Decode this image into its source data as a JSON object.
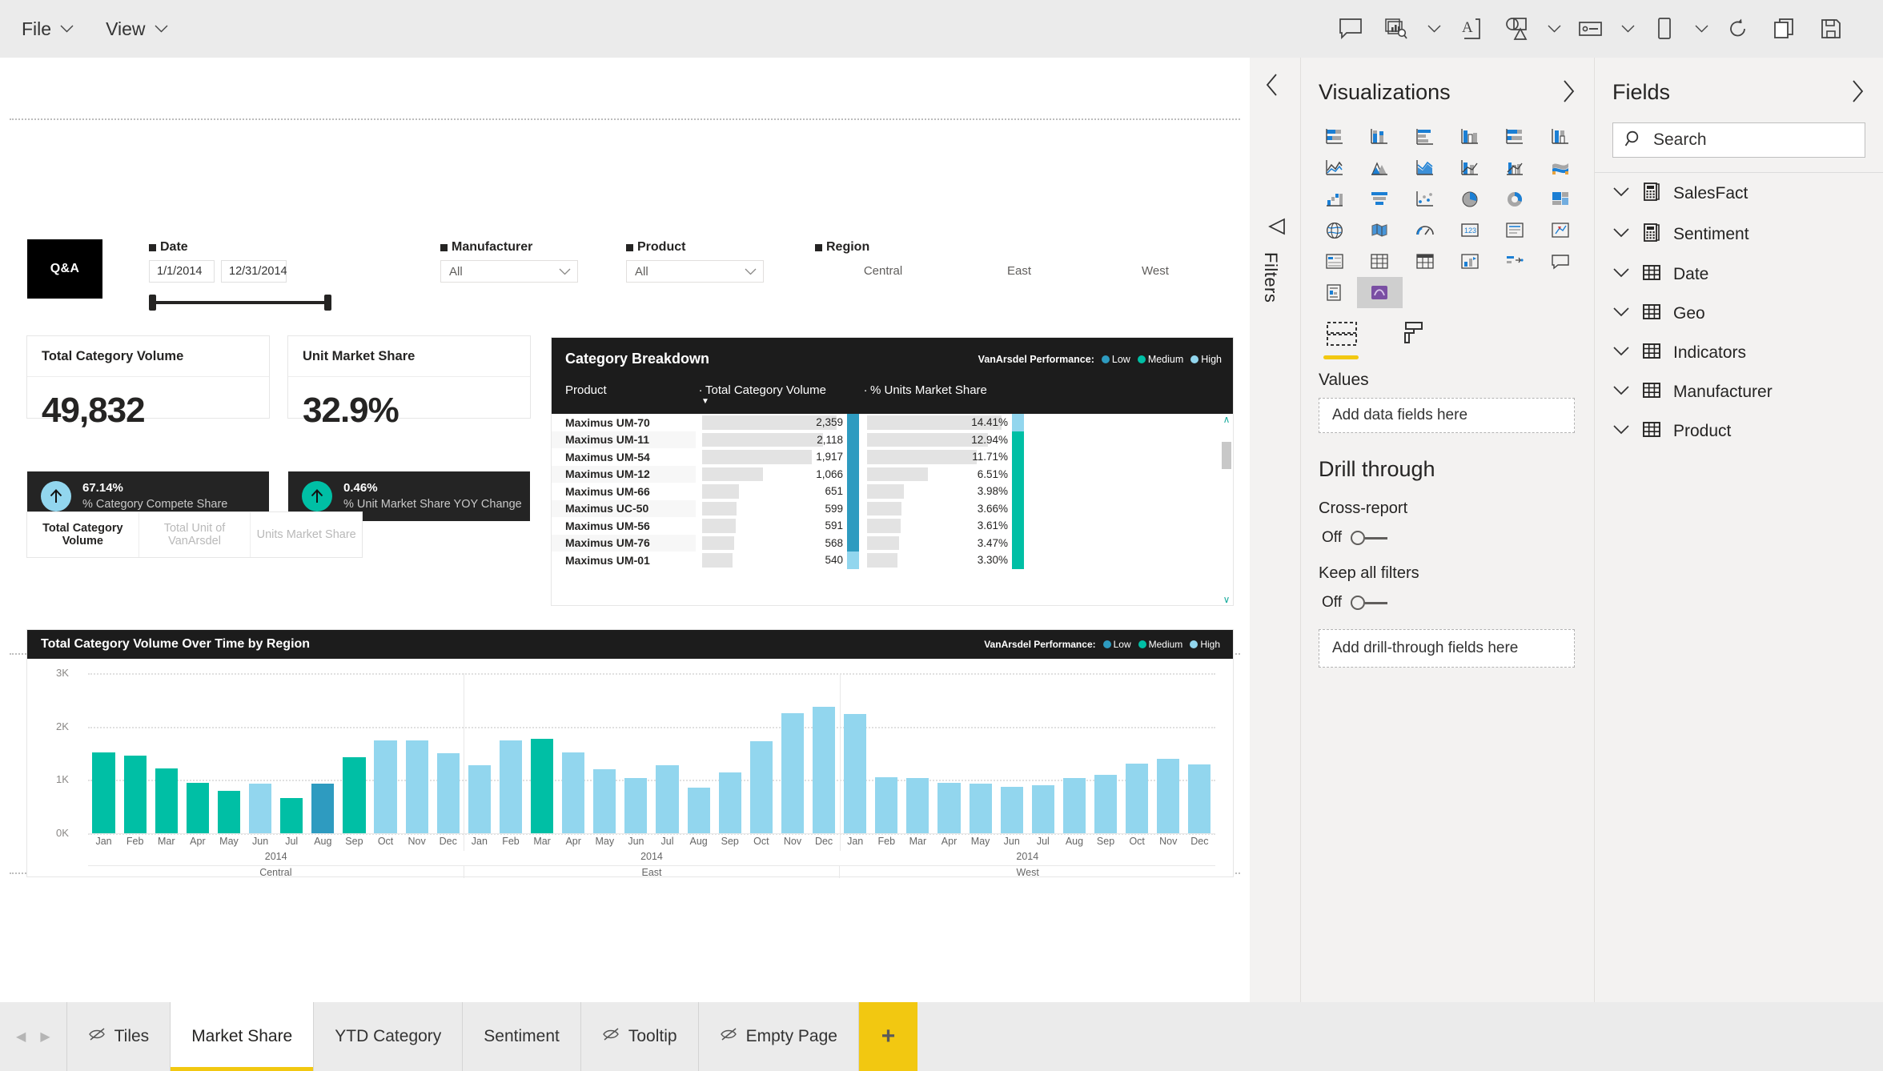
{
  "ribbon": {
    "menus": [
      {
        "label": "File"
      },
      {
        "label": "View"
      }
    ],
    "tools": [
      {
        "name": "comment-icon",
        "title": "Comment"
      },
      {
        "name": "visual-gallery-icon",
        "title": "From Marketplace"
      },
      {
        "name": "text-box-icon",
        "title": "Text box"
      },
      {
        "name": "shapes-icon",
        "title": "Shapes"
      },
      {
        "name": "buttons-icon",
        "title": "Buttons"
      },
      {
        "name": "phone-layout-icon",
        "title": "Phone layout"
      },
      {
        "name": "refresh-icon",
        "title": "Refresh"
      },
      {
        "name": "duplicate-page-icon",
        "title": "Duplicate page"
      },
      {
        "name": "save-icon",
        "title": "Save"
      }
    ]
  },
  "canvas": {
    "qna_label": "Q&A",
    "slicers": {
      "date": {
        "title": "Date",
        "start": "1/1/2014",
        "end": "12/31/2014"
      },
      "manufacturer": {
        "title": "Manufacturer",
        "value": "All"
      },
      "product": {
        "title": "Product",
        "value": "All"
      },
      "region": {
        "title": "Region",
        "items": [
          "Central",
          "East",
          "West"
        ]
      }
    },
    "kpi_cards": [
      {
        "title": "Total Category Volume",
        "value": "49,832",
        "delta_value": "67.14%",
        "delta_label": "% Category Compete Share",
        "delta_color": "#92D6EE"
      },
      {
        "title": "Unit Market Share",
        "value": "32.9%",
        "delta_value": "0.46%",
        "delta_label": "% Unit Market Share YOY Change",
        "delta_color": "#00BFA5"
      }
    ],
    "measure_tabs": [
      {
        "label": "Total Category Volume",
        "active": true
      },
      {
        "label": "Total Unit of VanArsdel",
        "active": false
      },
      {
        "label": "Units Market Share",
        "active": false
      }
    ],
    "category_breakdown": {
      "title": "Category Breakdown",
      "legend_title": "VanArsdel Performance:",
      "legend": [
        {
          "label": "Low",
          "color": "#2E9BC0"
        },
        {
          "label": "Medium",
          "color": "#00BFA5"
        },
        {
          "label": "High",
          "color": "#92D6EE"
        }
      ],
      "columns": [
        "Product",
        "Total Category Volume",
        "% Units Market Share"
      ],
      "sorted_by": "Total Category Volume",
      "rows": [
        {
          "product": "Maximus UM-70",
          "volume": "2,359",
          "volume_num": 2359,
          "share": "14.41%",
          "share_num": 14.41,
          "vol_flag": "#2E9BC0",
          "share_flag": "#92D6EE"
        },
        {
          "product": "Maximus UM-11",
          "volume": "2,118",
          "volume_num": 2118,
          "share": "12.94%",
          "share_num": 12.94,
          "vol_flag": "#2E9BC0",
          "share_flag": "#00BFA5"
        },
        {
          "product": "Maximus UM-54",
          "volume": "1,917",
          "volume_num": 1917,
          "share": "11.71%",
          "share_num": 11.71,
          "vol_flag": "#2E9BC0",
          "share_flag": "#00BFA5"
        },
        {
          "product": "Maximus UM-12",
          "volume": "1,066",
          "volume_num": 1066,
          "share": "6.51%",
          "share_num": 6.51,
          "vol_flag": "#2E9BC0",
          "share_flag": "#00BFA5"
        },
        {
          "product": "Maximus UM-66",
          "volume": "651",
          "volume_num": 651,
          "share": "3.98%",
          "share_num": 3.98,
          "vol_flag": "#2E9BC0",
          "share_flag": "#00BFA5"
        },
        {
          "product": "Maximus UC-50",
          "volume": "599",
          "volume_num": 599,
          "share": "3.66%",
          "share_num": 3.66,
          "vol_flag": "#2E9BC0",
          "share_flag": "#00BFA5"
        },
        {
          "product": "Maximus UM-56",
          "volume": "591",
          "volume_num": 591,
          "share": "3.61%",
          "share_num": 3.61,
          "vol_flag": "#2E9BC0",
          "share_flag": "#00BFA5"
        },
        {
          "product": "Maximus UM-76",
          "volume": "568",
          "volume_num": 568,
          "share": "3.47%",
          "share_num": 3.47,
          "vol_flag": "#2E9BC0",
          "share_flag": "#00BFA5"
        },
        {
          "product": "Maximus UM-01",
          "volume": "540",
          "volume_num": 540,
          "share": "3.30%",
          "share_num": 3.3,
          "vol_flag": "#92D6EE",
          "share_flag": "#00BFA5"
        }
      ]
    },
    "chart_panel": {
      "title": "Total Category Volume Over Time by Region",
      "legend_title": "VanArsdel Performance:",
      "legend": [
        {
          "label": "Low",
          "color": "#2E9BC0"
        },
        {
          "label": "Medium",
          "color": "#00BFA5"
        },
        {
          "label": "High",
          "color": "#92D6EE"
        }
      ]
    }
  },
  "chart_data": {
    "type": "bar",
    "title": "Total Category Volume Over Time by Region",
    "xlabel": "",
    "ylabel": "",
    "ylim": [
      0,
      3000
    ],
    "ytick_labels": [
      "0K",
      "1K",
      "2K",
      "3K"
    ],
    "ytick_values": [
      0,
      1000,
      2000,
      3000
    ],
    "grid": true,
    "legend_position": "top-right",
    "year": "2014",
    "group_label_key": "Region",
    "categories": [
      "Jan",
      "Feb",
      "Mar",
      "Apr",
      "May",
      "Jun",
      "Jul",
      "Aug",
      "Sep",
      "Oct",
      "Nov",
      "Dec",
      "Jan",
      "Feb",
      "Mar",
      "Apr",
      "May",
      "Jun",
      "Jul",
      "Aug",
      "Sep",
      "Oct",
      "Nov",
      "Dec",
      "Jan",
      "Feb",
      "Mar",
      "Apr",
      "May",
      "Jun",
      "Jul",
      "Aug",
      "Sep",
      "Oct",
      "Nov",
      "Dec"
    ],
    "groups": [
      {
        "name": "Central",
        "count": 12
      },
      {
        "name": "East",
        "count": 12
      },
      {
        "name": "West",
        "count": 12
      }
    ],
    "series": [
      {
        "name": "Total Category Volume",
        "values": [
          1510,
          1450,
          1210,
          940,
          790,
          930,
          660,
          930,
          1430,
          1740,
          1740,
          1500,
          1270,
          1740,
          1770,
          1510,
          1200,
          1040,
          1270,
          860,
          1140,
          1720,
          2250,
          2370,
          2230,
          1050,
          1030,
          940,
          930,
          870,
          900,
          1040,
          1100,
          1310,
          1400,
          1290
        ],
        "colors": [
          "#00BFA5",
          "#00BFA5",
          "#00BFA5",
          "#00BFA5",
          "#00BFA5",
          "#92D6EE",
          "#00BFA5",
          "#2E9BC0",
          "#00BFA5",
          "#92D6EE",
          "#92D6EE",
          "#92D6EE",
          "#92D6EE",
          "#92D6EE",
          "#00BFA5",
          "#92D6EE",
          "#92D6EE",
          "#92D6EE",
          "#92D6EE",
          "#92D6EE",
          "#92D6EE",
          "#92D6EE",
          "#92D6EE",
          "#92D6EE",
          "#92D6EE",
          "#92D6EE",
          "#92D6EE",
          "#92D6EE",
          "#92D6EE",
          "#92D6EE",
          "#92D6EE",
          "#92D6EE",
          "#92D6EE",
          "#92D6EE",
          "#92D6EE",
          "#92D6EE"
        ]
      }
    ]
  },
  "visualizations_pane": {
    "title": "Visualizations",
    "icons": [
      "stacked-bar-chart-icon",
      "stacked-column-chart-icon",
      "clustered-bar-chart-icon",
      "clustered-column-chart-icon",
      "100-stacked-bar-chart-icon",
      "100-stacked-column-chart-icon",
      "line-chart-icon",
      "area-chart-icon",
      "stacked-area-chart-icon",
      "line-stacked-column-chart-icon",
      "line-clustered-column-chart-icon",
      "ribbon-chart-icon",
      "waterfall-chart-icon",
      "funnel-chart-icon",
      "scatter-chart-icon",
      "pie-chart-icon",
      "donut-chart-icon",
      "treemap-icon",
      "map-icon",
      "filled-map-icon",
      "gauge-icon",
      "card-icon",
      "multi-row-card-icon",
      "kpi-icon",
      "slicer-icon",
      "table-icon",
      "matrix-icon",
      "r-script-visual-icon",
      "key-influencers-icon",
      "q-and-a-icon",
      "paginated-report-icon",
      "custom-visual-icon"
    ],
    "selected_icon": "custom-visual-icon",
    "format_tabs": [
      {
        "name": "fields-tab",
        "active": true
      },
      {
        "name": "format-tab",
        "active": false
      }
    ],
    "values_label": "Values",
    "values_placeholder": "Add data fields here",
    "drill_through": {
      "title": "Drill through",
      "cross_report_label": "Cross-report",
      "cross_report_state": "Off",
      "keep_all_filters_label": "Keep all filters",
      "keep_all_filters_state": "Off",
      "placeholder": "Add drill-through fields here"
    }
  },
  "fields_pane": {
    "title": "Fields",
    "search_placeholder": "Search",
    "tables": [
      {
        "name": "SalesFact",
        "icon": "measure-table-icon"
      },
      {
        "name": "Sentiment",
        "icon": "measure-table-icon"
      },
      {
        "name": "Date",
        "icon": "table-icon"
      },
      {
        "name": "Geo",
        "icon": "table-icon"
      },
      {
        "name": "Indicators",
        "icon": "table-icon"
      },
      {
        "name": "Manufacturer",
        "icon": "table-icon"
      },
      {
        "name": "Product",
        "icon": "table-icon"
      }
    ]
  },
  "page_tabs": {
    "tabs": [
      {
        "label": "Tiles",
        "hidden": true,
        "active": false
      },
      {
        "label": "Market Share",
        "hidden": false,
        "active": true
      },
      {
        "label": "YTD Category",
        "hidden": false,
        "active": false
      },
      {
        "label": "Sentiment",
        "hidden": false,
        "active": false
      },
      {
        "label": "Tooltip",
        "hidden": true,
        "active": false
      },
      {
        "label": "Empty Page",
        "hidden": true,
        "active": false
      }
    ],
    "add_label": "+"
  }
}
